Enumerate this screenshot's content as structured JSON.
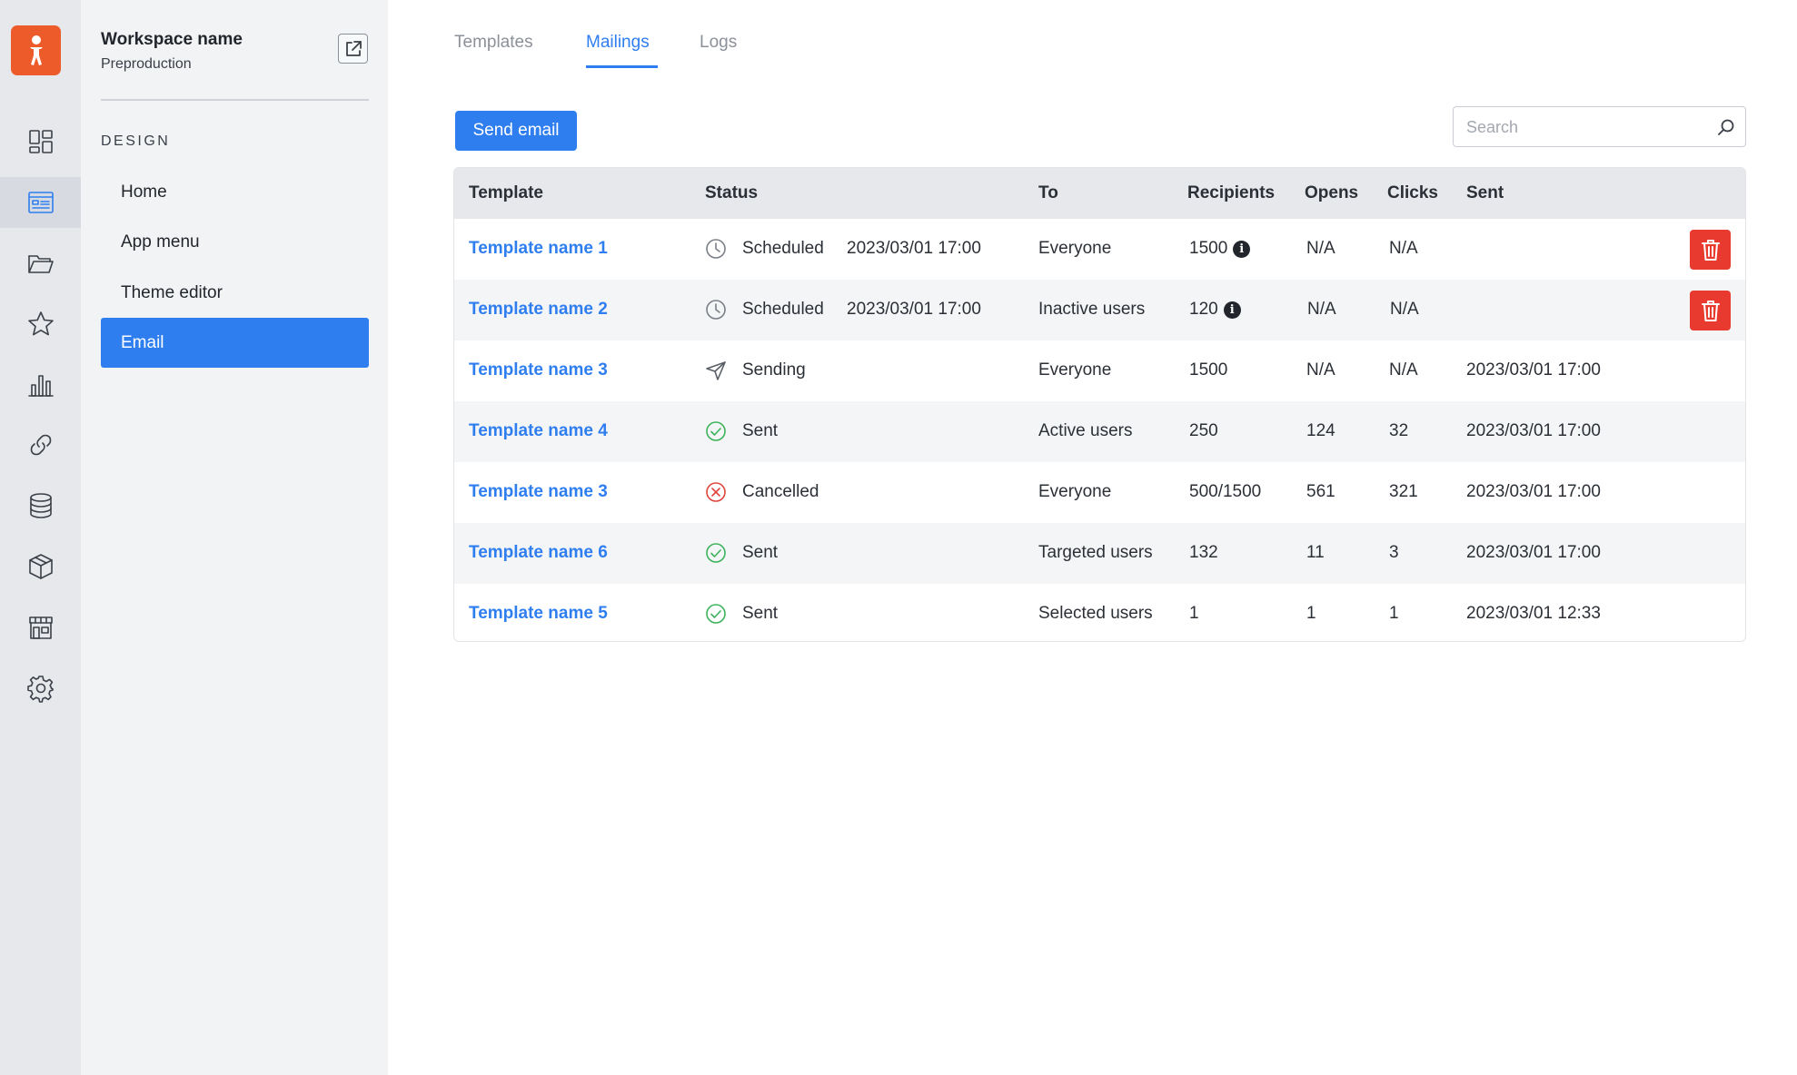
{
  "workspace": {
    "name": "Workspace name",
    "environment": "Preproduction"
  },
  "rail": {
    "items": [
      {
        "icon": "dashboard-icon"
      },
      {
        "icon": "design-icon",
        "active": true
      },
      {
        "icon": "folder-icon"
      },
      {
        "icon": "star-icon"
      },
      {
        "icon": "chart-icon"
      },
      {
        "icon": "link-icon"
      },
      {
        "icon": "database-icon"
      },
      {
        "icon": "box-icon"
      },
      {
        "icon": "store-icon"
      },
      {
        "icon": "gear-icon"
      }
    ]
  },
  "sidebar": {
    "heading": "DESIGN",
    "items": [
      {
        "label": "Home"
      },
      {
        "label": "App menu"
      },
      {
        "label": "Theme editor"
      },
      {
        "label": "Email",
        "active": true
      }
    ]
  },
  "tabs": [
    {
      "label": "Templates"
    },
    {
      "label": "Mailings",
      "active": true
    },
    {
      "label": "Logs"
    }
  ],
  "toolbar": {
    "send_label": "Send email",
    "search_placeholder": "Search"
  },
  "table": {
    "headers": {
      "template": "Template",
      "status": "Status",
      "to": "To",
      "recipients": "Recipients",
      "opens": "Opens",
      "clicks": "Clicks",
      "sent": "Sent"
    },
    "rows": [
      {
        "template": "Template name 1",
        "status": "Scheduled",
        "status_icon": "clock-icon",
        "scheduled": "2023/03/01 17:00",
        "to": "Everyone",
        "recipients": "1500",
        "opens": "N/A",
        "clicks": "N/A",
        "sent": "",
        "info": true,
        "deletable": true
      },
      {
        "template": "Template name 2",
        "status": "Scheduled",
        "status_icon": "clock-icon",
        "scheduled": "2023/03/01 17:00",
        "to": "Inactive users",
        "recipients": "120",
        "opens": "N/A",
        "clicks": "N/A",
        "sent": "",
        "info": true,
        "deletable": true
      },
      {
        "template": "Template name 3",
        "status": "Sending",
        "status_icon": "send-icon",
        "scheduled": "",
        "to": "Everyone",
        "recipients": "1500",
        "opens": "N/A",
        "clicks": "N/A",
        "sent": "2023/03/01 17:00",
        "info": false,
        "deletable": false
      },
      {
        "template": "Template name 4",
        "status": "Sent",
        "status_icon": "check-circle-icon",
        "scheduled": "",
        "to": "Active users",
        "recipients": "250",
        "opens": "124",
        "clicks": "32",
        "sent": "2023/03/01 17:00",
        "info": false,
        "deletable": false
      },
      {
        "template": "Template name 3",
        "status": "Cancelled",
        "status_icon": "cancel-circle-icon",
        "scheduled": "",
        "to": "Everyone",
        "recipients": "500/1500",
        "opens": "561",
        "clicks": "321",
        "sent": "2023/03/01 17:00",
        "info": false,
        "deletable": false
      },
      {
        "template": "Template name 6",
        "status": "Sent",
        "status_icon": "check-circle-icon",
        "scheduled": "",
        "to": "Targeted users",
        "recipients": "132",
        "opens": "11",
        "clicks": "3",
        "sent": "2023/03/01 17:00",
        "info": false,
        "deletable": false
      },
      {
        "template": "Template name 5",
        "status": "Sent",
        "status_icon": "check-circle-icon",
        "scheduled": "",
        "to": "Selected users",
        "recipients": "1",
        "opens": "1",
        "clicks": "1",
        "sent": "2023/03/01 12:33",
        "info": false,
        "deletable": false
      }
    ]
  },
  "colors": {
    "accent": "#2f7ef0",
    "brand": "#ee5b2a",
    "danger": "#e83a2f",
    "success": "#3cb35a",
    "cancelled": "#e0443a",
    "muted_icon": "#7a7f87"
  }
}
